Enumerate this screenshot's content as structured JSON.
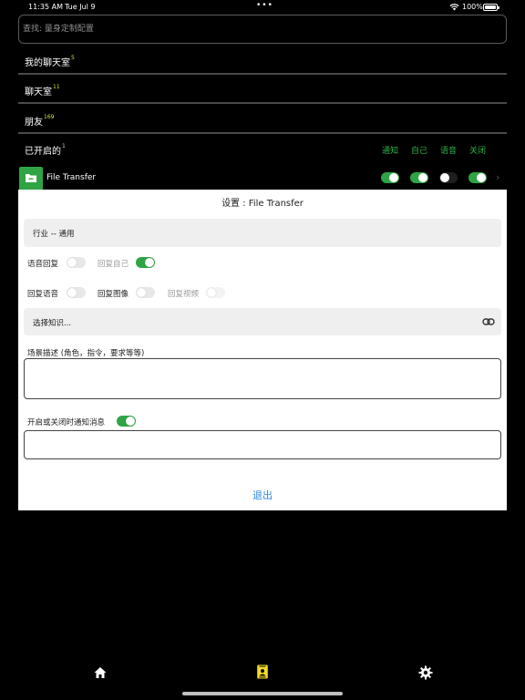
{
  "status_bar": {
    "time": "11:35 AM",
    "date": "Tue Jul 9",
    "battery": "100%"
  },
  "search": {
    "placeholder": "查找: 量身定制配置"
  },
  "rows": [
    {
      "label": "我的聊天室",
      "count": "5"
    },
    {
      "label": "聊天室",
      "count": "11"
    },
    {
      "label": "朋友",
      "count": "169"
    },
    {
      "label": "已开启的",
      "count": "1"
    }
  ],
  "columns": [
    "通知",
    "自己",
    "语音",
    "关闭"
  ],
  "file_transfer": {
    "name": "File Transfer",
    "toggles": [
      true,
      true,
      false,
      true
    ]
  },
  "sheet": {
    "title": "设置 : File Transfer",
    "industry": "行业 -- 通用",
    "options_row1": [
      {
        "label": "语音回复",
        "state": "off"
      },
      {
        "label": "回复自己",
        "state": "on"
      }
    ],
    "options_row2": [
      {
        "label": "回复语音",
        "state": "off"
      },
      {
        "label": "回复图像",
        "state": "off"
      },
      {
        "label": "回复视频",
        "state": "faint"
      }
    ],
    "knowledge": "选择知识...",
    "scene_label": "场景描述 (角色，指令，要求等等)",
    "scene_value": "",
    "notify_label": "开启或关闭时通知消息",
    "notify_on": true,
    "notify_value": "",
    "exit": "退出"
  },
  "colors": {
    "accent_green": "#2fa444",
    "link_blue": "#2a8ae0",
    "count_yellow": "#d7e53f",
    "tab_active": "#f5dc28"
  },
  "tabs": [
    {
      "name": "home",
      "active": false
    },
    {
      "name": "contacts",
      "active": true
    },
    {
      "name": "settings",
      "active": false
    }
  ]
}
